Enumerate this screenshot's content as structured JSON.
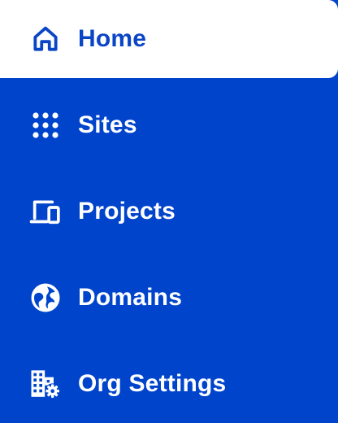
{
  "sidebar": {
    "items": [
      {
        "label": "Home",
        "icon": "home-icon",
        "active": true
      },
      {
        "label": "Sites",
        "icon": "grid-dots-icon",
        "active": false
      },
      {
        "label": "Projects",
        "icon": "devices-icon",
        "active": false
      },
      {
        "label": "Domains",
        "icon": "globe-icon",
        "active": false
      },
      {
        "label": "Org Settings",
        "icon": "building-gear-icon",
        "active": false
      }
    ]
  },
  "colors": {
    "background": "#0044cc",
    "active_background": "#ffffff",
    "active_text": "#0a45c5",
    "text": "#ffffff"
  }
}
